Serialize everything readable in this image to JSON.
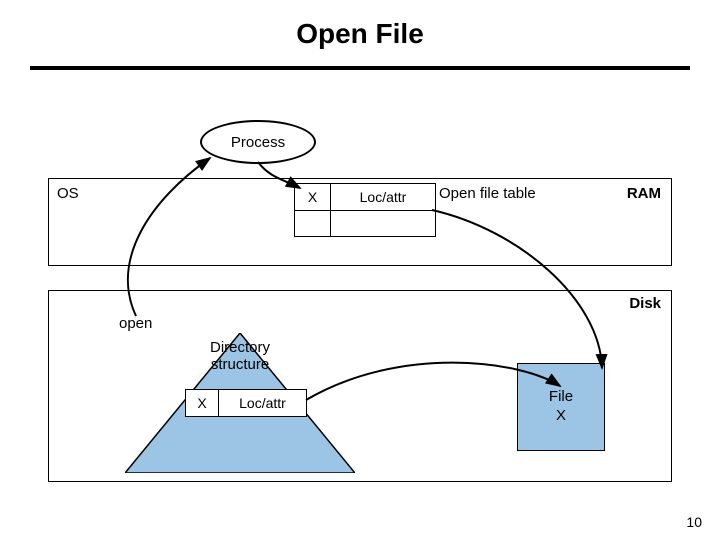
{
  "title": "Open File",
  "process_label": "Process",
  "ram": {
    "os_label": "OS",
    "ram_label": "RAM",
    "open_file_table_label": "Open file table",
    "row": {
      "name": "X",
      "attr": "Loc/attr"
    }
  },
  "disk": {
    "disk_label": "Disk",
    "open_label": "open",
    "directory": {
      "label_line1": "Directory",
      "label_line2": "structure",
      "name": "X",
      "attr": "Loc/attr"
    },
    "file": {
      "label_line1": "File",
      "label_line2": "X"
    }
  },
  "page_number": "10"
}
